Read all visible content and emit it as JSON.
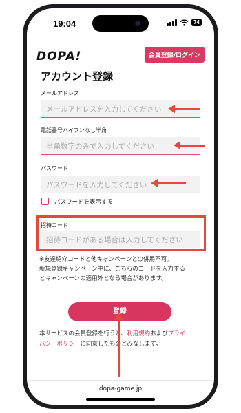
{
  "status_bar": {
    "time": "19:04",
    "battery": "74"
  },
  "header": {
    "logo": "DOPA!",
    "login_button": "会員登録/ログイン"
  },
  "form": {
    "title": "アカウント登録",
    "email": {
      "label": "メールアドレス",
      "placeholder": "メールアドレスを入力してください"
    },
    "phone": {
      "label": "電話番号ハイフンなし半角",
      "placeholder": "半角数字のみで入力してください"
    },
    "password": {
      "label": "パスワード",
      "placeholder": "パスワードを入力してください"
    },
    "show_password": "パスワードを表示する",
    "invite": {
      "label": "招待コード",
      "placeholder": "招待コードがある場合は入力してください"
    },
    "note_lines": [
      "※友達紹介コードと他キャンペーンとの併用不可。",
      "新規登録キャンペーン中に、こちらのコードを入力する",
      "とキャンペーンの適用外となる場合があります。"
    ],
    "register_button": "登録",
    "terms": {
      "prefix": "本サービスの会員登録を行うと、",
      "link1": "利用規約",
      "middle": "および",
      "link2a": "プライ",
      "link2b": "バシーポリシー",
      "suffix": "に同意したものとみなします。"
    }
  },
  "footer": {
    "domain": "dopa-game.jp"
  },
  "colors": {
    "accent": "#d83a62",
    "annotation": "#e24a3a"
  }
}
